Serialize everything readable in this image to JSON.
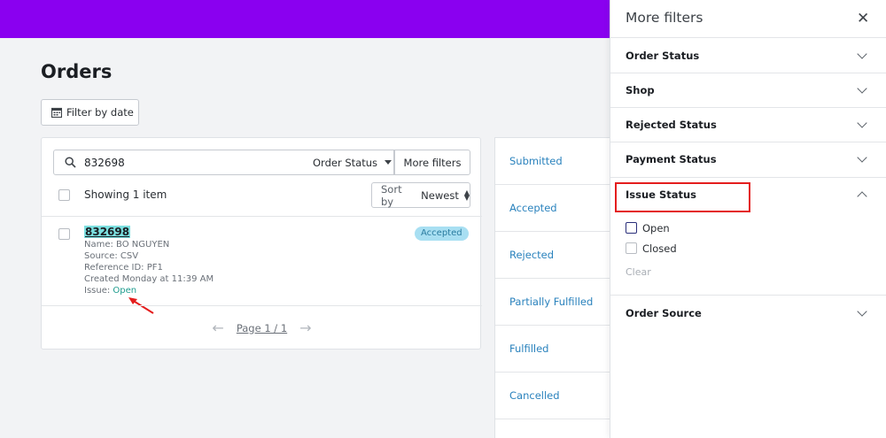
{
  "header": {
    "brand_color": "#8a00f0"
  },
  "page": {
    "title": "Orders",
    "filter_by_date_label": "Filter by date"
  },
  "orders_panel": {
    "search": {
      "value": "832698"
    },
    "order_status_label": "Order Status",
    "more_filters_label": "More filters",
    "showing_label": "Showing 1 item",
    "sort": {
      "prefix": "Sort by",
      "value": "Newest"
    },
    "order": {
      "id": "832698",
      "name": "Name: BO NGUYEN",
      "source": "Source: CSV",
      "reference": "Reference ID: PF1",
      "created": "Created Monday at 11:39 AM",
      "issue_prefix": "Issue:",
      "issue_value": "Open",
      "status_badge": "Accepted"
    },
    "pagination": {
      "label": "Page 1 / 1"
    }
  },
  "status_list": {
    "items": [
      "Submitted",
      "Accepted",
      "Rejected",
      "Partially Fulfilled",
      "Fulfilled",
      "Cancelled"
    ]
  },
  "drawer": {
    "title": "More filters",
    "sections": [
      "Order Status",
      "Shop",
      "Rejected Status",
      "Payment Status",
      "Issue Status",
      "Order Source"
    ],
    "issue_status_options": [
      "Open",
      "Closed"
    ],
    "clear_label": "Clear"
  }
}
